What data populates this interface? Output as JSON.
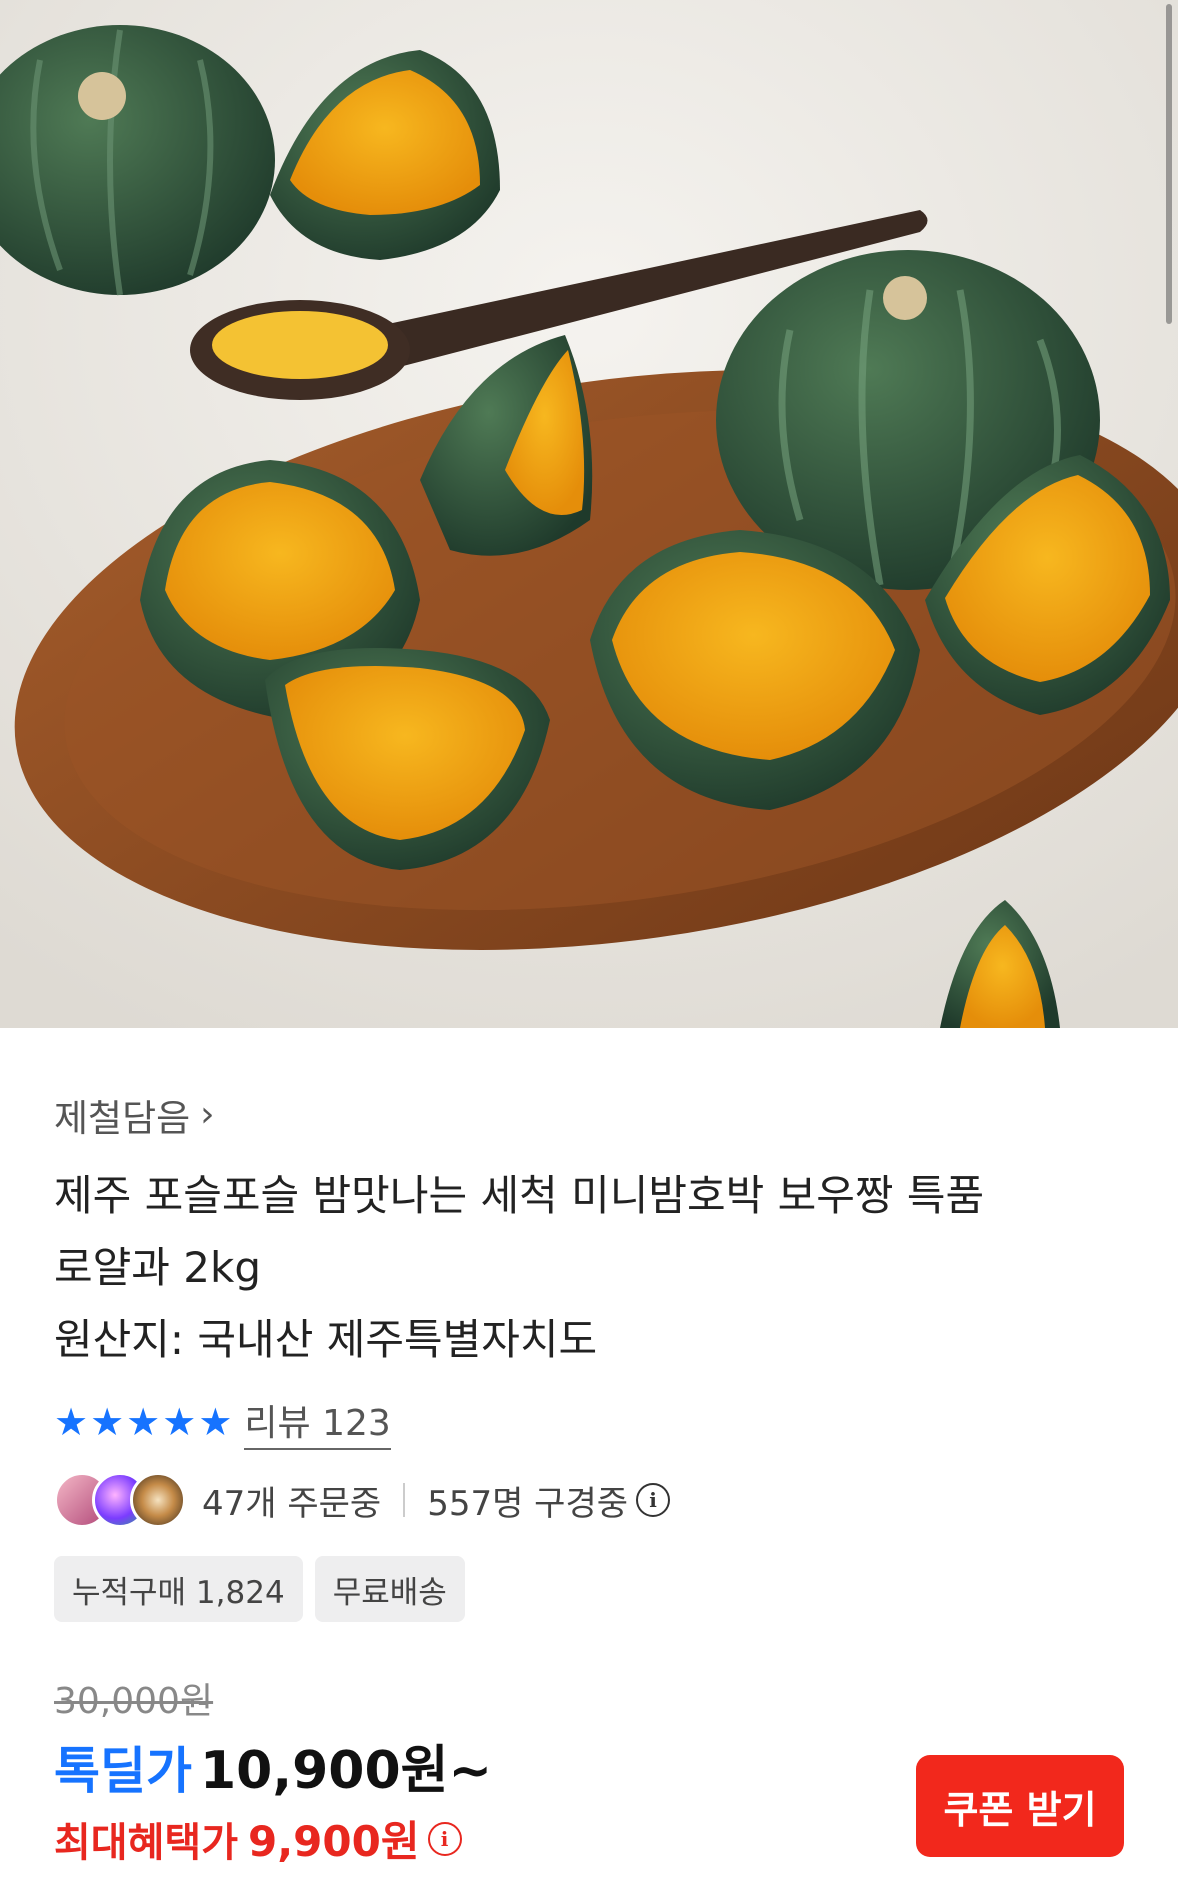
{
  "hero": {
    "image_label": "pumpkin-product-photo",
    "colors": {
      "background": "#ece9e4",
      "board": "#8a4a22",
      "rind": "#2f4d3a",
      "flesh": "#f2a514"
    }
  },
  "brand": {
    "name": "제철담음",
    "chevron": "›"
  },
  "title": {
    "line1": "제주 포슬포슬 밤맛나는 세척 미니밤호박 보우짱 특품",
    "line2": "로얄과 2kg",
    "line3": "원산지: 국내산 제주특별자치도"
  },
  "rating": {
    "stars": "★★★★★",
    "review_label": "리뷰 123",
    "score": 5
  },
  "activity": {
    "orders": "47개 주문중",
    "viewers": "557명 구경중",
    "info_glyph": "i"
  },
  "tags": [
    "누적구매 1,824",
    "무료배송"
  ],
  "price": {
    "original": "30,000원",
    "deal_label": "톡딜가",
    "deal_price": "10,900원~",
    "max_label": "최대혜택가",
    "max_price": "9,900원",
    "info_glyph": "i"
  },
  "coupon_button": {
    "label": "쿠폰 받기",
    "color": "#f2281c"
  },
  "accent": {
    "blue": "#1673ff",
    "red": "#e8271f"
  }
}
